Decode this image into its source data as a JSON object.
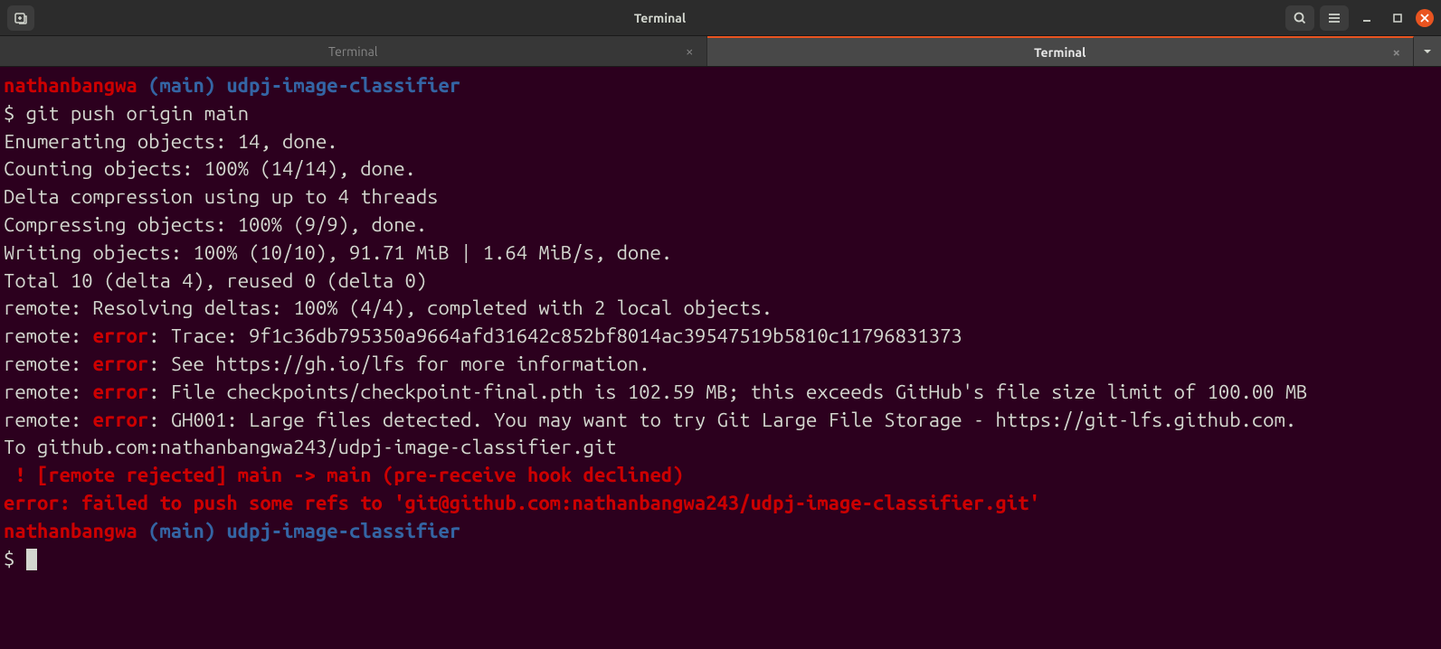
{
  "window": {
    "title": "Terminal"
  },
  "tabs": [
    {
      "label": "Terminal"
    },
    {
      "label": "Terminal"
    }
  ],
  "prompt1": {
    "user": "nathanbangwa",
    "branch": "(main)",
    "path": "udpj-image-classifier"
  },
  "command": "git push origin main",
  "output": {
    "l1": "Enumerating objects: 14, done.",
    "l2": "Counting objects: 100% (14/14), done.",
    "l3": "Delta compression using up to 4 threads",
    "l4": "Compressing objects: 100% (9/9), done.",
    "l5": "Writing objects: 100% (10/10), 91.71 MiB | 1.64 MiB/s, done.",
    "l6": "Total 10 (delta 4), reused 0 (delta 0)",
    "l7": "remote: Resolving deltas: 100% (4/4), completed with 2 local objects.",
    "r1a": "remote: ",
    "r1e": "error",
    "r1b": ": Trace: 9f1c36db795350a9664afd31642c852bf8014ac39547519b5810c11796831373",
    "r2a": "remote: ",
    "r2e": "error",
    "r2b": ": See https://gh.io/lfs for more information.",
    "r3a": "remote: ",
    "r3e": "error",
    "r3b": ": File checkpoints/checkpoint-final.pth is 102.59 MB; this exceeds GitHub's file size limit of 100.00 MB",
    "r4a": "remote: ",
    "r4e": "error",
    "r4b": ": GH001: Large files detected. You may want to try Git Large File Storage - https://git-lfs.github.com.",
    "to": "To github.com:nathanbangwa243/udpj-image-classifier.git",
    "rej": " ! [remote rejected] main -> main (pre-receive hook declined)",
    "push_err": "error: failed to push some refs to 'git@github.com:nathanbangwa243/udpj-image-classifier.git'"
  },
  "prompt2": {
    "user": "nathanbangwa",
    "branch": "(main)",
    "path": "udpj-image-classifier"
  },
  "dollar": "$"
}
